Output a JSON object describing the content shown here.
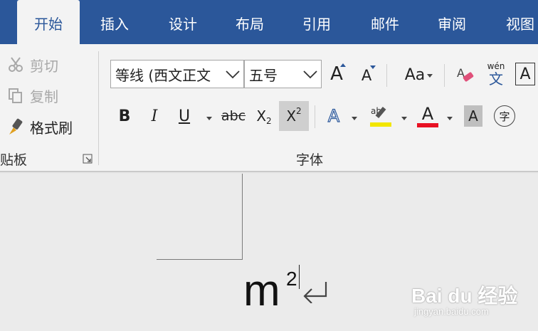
{
  "tabs": [
    {
      "label": "开始",
      "active": true
    },
    {
      "label": "插入"
    },
    {
      "label": "设计"
    },
    {
      "label": "布局"
    },
    {
      "label": "引用"
    },
    {
      "label": "邮件"
    },
    {
      "label": "审阅"
    },
    {
      "label": "视图"
    }
  ],
  "clipboard": {
    "cut": "剪切",
    "copy": "复制",
    "format_painter": "格式刷",
    "group_label": "贴板"
  },
  "font": {
    "font_name": "等线 (西文正文",
    "font_size": "五号",
    "grow": "A",
    "shrink": "A",
    "change_case": "Aa",
    "phonetic_top": "wén",
    "phonetic_bottom": "文",
    "bold": "B",
    "italic": "I",
    "underline": "U",
    "strike": "abc",
    "subscript_base": "X",
    "subscript_mark": "2",
    "superscript_base": "X",
    "superscript_mark": "2",
    "text_effects": "A",
    "highlight_mark": "ab",
    "font_color": "A",
    "char_shading": "A",
    "enclose": "字",
    "group_label": "字体",
    "highlight_color": "#f2e600",
    "font_color_bar": "#e81123",
    "accent": "#2b579a"
  },
  "document": {
    "text": "m",
    "superscript": "2"
  },
  "watermark": {
    "main": "Bai du 经验",
    "sub": "jingyan.baidu.com"
  }
}
